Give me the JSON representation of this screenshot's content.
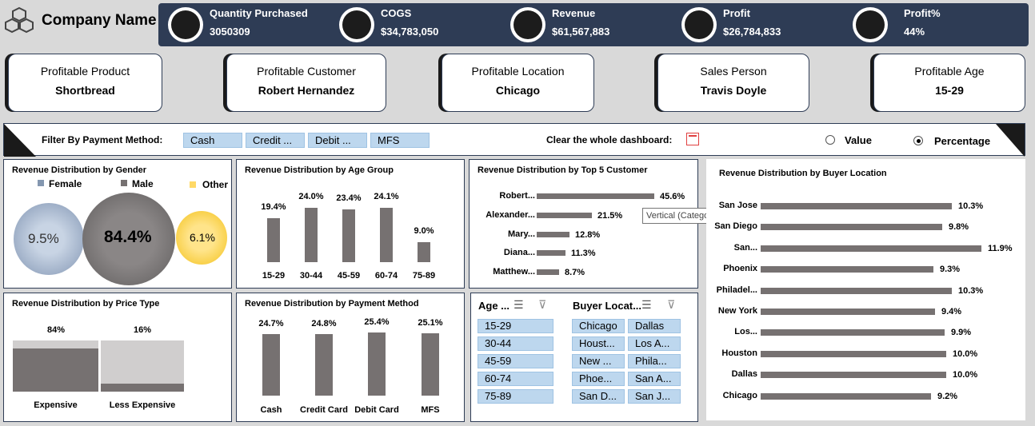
{
  "company": "Company Name",
  "kpis": [
    {
      "label": "Quantity Purchased",
      "value": "3050309",
      "icon": "shopping-bag-icon"
    },
    {
      "label": "COGS",
      "value": "$34,783,050",
      "icon": "cost-chart-icon"
    },
    {
      "label": "Revenue",
      "value": "$61,567,883",
      "icon": "revenue-icon"
    },
    {
      "label": "Profit",
      "value": "$26,784,833",
      "icon": "profit-coins-icon"
    },
    {
      "label": "Profit%",
      "value": "44%",
      "icon": "profit-percent-icon"
    }
  ],
  "cards": [
    {
      "label": "Profitable Product",
      "value": "Shortbread"
    },
    {
      "label": "Profitable Customer",
      "value": "Robert Hernandez"
    },
    {
      "label": "Profitable Location",
      "value": "Chicago"
    },
    {
      "label": "Sales Person",
      "value": "Travis Doyle"
    },
    {
      "label": "Profitable Age",
      "value": "15-29"
    }
  ],
  "filter": {
    "label": "Filter By Payment Method:",
    "chips": [
      "Cash",
      "Credit ...",
      "Debit ...",
      "MFS"
    ],
    "clear_label": "Clear the whole dashboard:",
    "radio_value": "Value",
    "radio_percentage": "Percentage",
    "selected": "Percentage"
  },
  "gender": {
    "title": "Revenue Distribution by Gender",
    "legend": [
      "Female",
      "Male",
      "Other"
    ],
    "colors": [
      "#8497b0",
      "#767171",
      "#ffd966"
    ],
    "values": [
      "9.5%",
      "84.4%",
      "6.1%"
    ]
  },
  "age_group": {
    "title": "Revenue Distribution by Age Group",
    "categories": [
      "15-29",
      "30-44",
      "45-59",
      "60-74",
      "75-89"
    ],
    "values": [
      "19.4%",
      "24.0%",
      "23.4%",
      "24.1%",
      "9.0%"
    ]
  },
  "top_customer": {
    "title": "Revenue Distribution by Top 5 Customer",
    "categories": [
      "Robert...",
      "Alexander...",
      "Mary...",
      "Diana...",
      "Matthew..."
    ],
    "values": [
      "45.6%",
      "21.5%",
      "12.8%",
      "11.3%",
      "8.7%"
    ],
    "tooltip": "Vertical (Category) Axis"
  },
  "buyer_location": {
    "title": "Revenue Distribution by Buyer Location",
    "categories": [
      "San Jose",
      "San Diego",
      "San...",
      "Phoenix",
      "Philadel...",
      "New York",
      "Los...",
      "Houston",
      "Dallas",
      "Chicago"
    ],
    "values": [
      "10.3%",
      "9.8%",
      "11.9%",
      "9.3%",
      "10.3%",
      "9.4%",
      "9.9%",
      "10.0%",
      "10.0%",
      "9.2%"
    ]
  },
  "price_type": {
    "title": "Revenue Distribution by Price Type",
    "categories": [
      "Expensive",
      "Less Expensive"
    ],
    "values": [
      "84%",
      "16%"
    ]
  },
  "payment_method": {
    "title": "Revenue Distribution by Payment Method",
    "categories": [
      "Cash",
      "Credit Card",
      "Debit Card",
      "MFS"
    ],
    "values": [
      "24.7%",
      "24.8%",
      "25.4%",
      "25.1%"
    ]
  },
  "slicers": {
    "age_title": "Age ...",
    "age_items": [
      "15-29",
      "30-44",
      "45-59",
      "60-74",
      "75-89"
    ],
    "loc_title": "Buyer Locat...",
    "loc_items_col1": [
      "Chicago",
      "Houst...",
      "New ...",
      "Phoe...",
      "San D..."
    ],
    "loc_items_col2": [
      "Dallas",
      "Los A...",
      "Phila...",
      "San A...",
      "San J..."
    ]
  },
  "chart_data": [
    {
      "type": "bar",
      "title": "Revenue Distribution by Age Group",
      "categories": [
        "15-29",
        "30-44",
        "45-59",
        "60-74",
        "75-89"
      ],
      "values": [
        19.4,
        24.0,
        23.4,
        24.1,
        9.0
      ]
    },
    {
      "type": "bar",
      "title": "Revenue Distribution by Top 5 Customer",
      "categories": [
        "Robert...",
        "Alexander...",
        "Mary...",
        "Diana...",
        "Matthew..."
      ],
      "values": [
        45.6,
        21.5,
        12.8,
        11.3,
        8.7
      ]
    },
    {
      "type": "bar",
      "title": "Revenue Distribution by Buyer Location",
      "categories": [
        "San Jose",
        "San Diego",
        "San...",
        "Phoenix",
        "Philadel...",
        "New York",
        "Los...",
        "Houston",
        "Dallas",
        "Chicago"
      ],
      "values": [
        10.3,
        9.8,
        11.9,
        9.3,
        10.3,
        9.4,
        9.9,
        10.0,
        10.0,
        9.2
      ]
    },
    {
      "type": "bar",
      "title": "Revenue Distribution by Payment Method",
      "categories": [
        "Cash",
        "Credit Card",
        "Debit Card",
        "MFS"
      ],
      "values": [
        24.7,
        24.8,
        25.4,
        25.1
      ]
    },
    {
      "type": "bar",
      "title": "Revenue Distribution by Price Type",
      "categories": [
        "Expensive",
        "Less Expensive"
      ],
      "values": [
        84,
        16
      ]
    },
    {
      "type": "scatter",
      "title": "Revenue Distribution by Gender",
      "series": [
        {
          "name": "Female",
          "values": [
            9.5
          ]
        },
        {
          "name": "Male",
          "values": [
            84.4
          ]
        },
        {
          "name": "Other",
          "values": [
            6.1
          ]
        }
      ]
    }
  ]
}
